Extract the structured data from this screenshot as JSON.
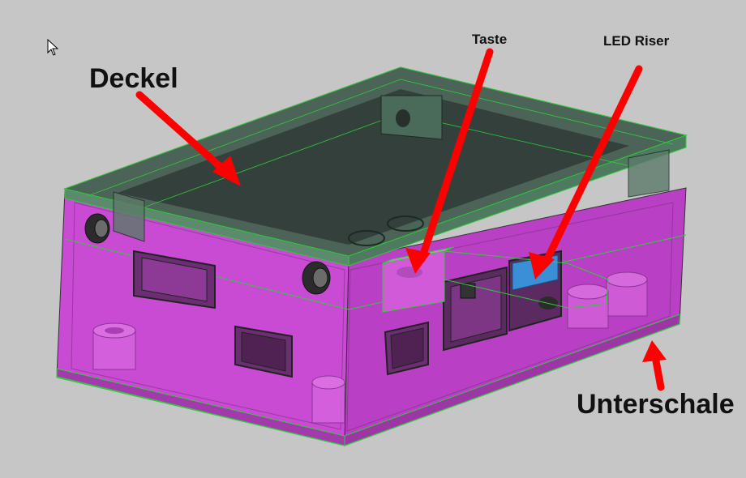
{
  "annotations": {
    "lid": "Deckel",
    "button": "Taste",
    "led_riser": "LED Riser",
    "bottom_shell": "Unterschale"
  },
  "colors": {
    "background": "#c6c6c6",
    "shell": "#c94ad3",
    "lid": "#3f5a4c",
    "edge": "#2ecc3a",
    "arrow": "#ff0000",
    "led": "#3a8fd6"
  },
  "icons": [
    "mouse-pointer-icon"
  ]
}
